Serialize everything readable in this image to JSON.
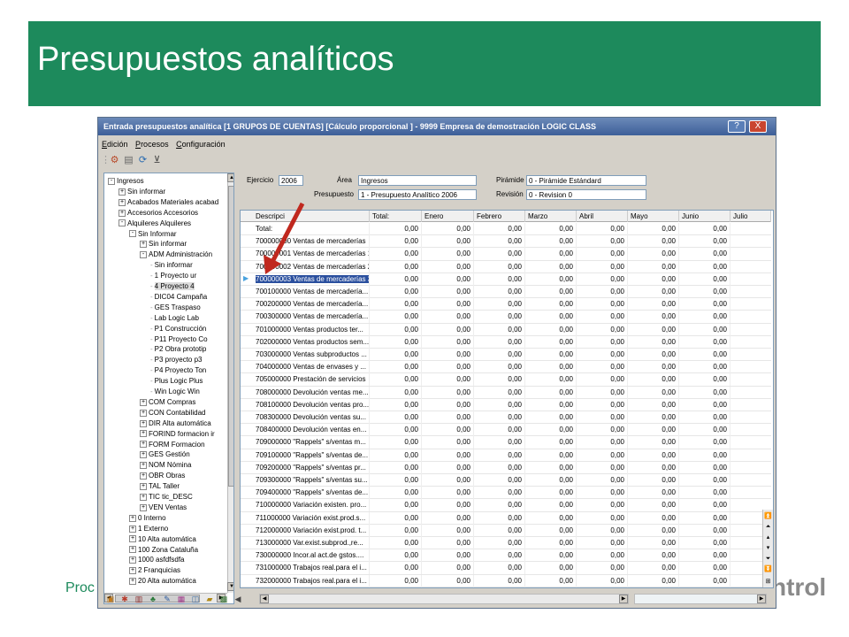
{
  "slide": {
    "title": "Presupuestos analíticos",
    "footer_left": "Proc",
    "footer_right": "ntrol",
    "banner_color": "#1d8a5c"
  },
  "window": {
    "title": "Entrada presupuestos analítica [1 GRUPOS DE CUENTAS] [Cálculo proporcional ] - 9999 Empresa de demostración LOGIC CLASS",
    "help_label": "?",
    "close_label": "X",
    "menu": [
      {
        "label": "Edición",
        "accel": "E"
      },
      {
        "label": "Procesos",
        "accel": "P"
      },
      {
        "label": "Configuración",
        "accel": "C"
      }
    ],
    "toolbar_icons": [
      "properties-icon",
      "document-icon",
      "refresh-icon",
      "filter-clear-icon"
    ]
  },
  "form": {
    "ejercicio_label": "Ejercicio",
    "ejercicio_value": "2006",
    "area_label": "Área",
    "area_value": "Ingresos",
    "piramide_label": "Pirámide",
    "piramide_value": "0 - Pirámide Estándard",
    "presupuesto_label": "Presupuesto",
    "presupuesto_value": "1 - Presupuesto Analítico 2006",
    "revision_label": "Revisión",
    "revision_value": "0 - Revision 0"
  },
  "tree": [
    {
      "label": "Ingresos",
      "level": 0,
      "exp": "-"
    },
    {
      "label": "Sin informar",
      "level": 1,
      "exp": "+"
    },
    {
      "label": "Acabados Materiales acabad",
      "level": 1,
      "exp": "+"
    },
    {
      "label": "Accesorios Accesorios",
      "level": 1,
      "exp": "+"
    },
    {
      "label": "Alquileres Alquileres",
      "level": 1,
      "exp": "-"
    },
    {
      "label": "Sin Informar",
      "level": 2,
      "exp": "-"
    },
    {
      "label": "Sin informar",
      "level": 3,
      "exp": "+"
    },
    {
      "label": "ADM Administración",
      "level": 3,
      "exp": "-"
    },
    {
      "label": "Sin informar",
      "level": 4,
      "exp": ""
    },
    {
      "label": "1    Proyecto ur",
      "level": 4,
      "exp": ""
    },
    {
      "label": "4 Proyecto 4",
      "level": 4,
      "exp": "",
      "selected": true
    },
    {
      "label": "DIC04 Campaña",
      "level": 4,
      "exp": ""
    },
    {
      "label": "GES   Traspaso",
      "level": 4,
      "exp": ""
    },
    {
      "label": "Lab   Logic Lab",
      "level": 4,
      "exp": ""
    },
    {
      "label": "P1 Construcción",
      "level": 4,
      "exp": ""
    },
    {
      "label": "P11 Proyecto Co",
      "level": 4,
      "exp": ""
    },
    {
      "label": "P2 Obra prototip",
      "level": 4,
      "exp": ""
    },
    {
      "label": "P3 proyecto p3",
      "level": 4,
      "exp": ""
    },
    {
      "label": "P4 Proyecto Ton",
      "level": 4,
      "exp": ""
    },
    {
      "label": "Plus   Logic Plus",
      "level": 4,
      "exp": ""
    },
    {
      "label": "Win   Logic Win",
      "level": 4,
      "exp": ""
    },
    {
      "label": "COM Compras",
      "level": 3,
      "exp": "+"
    },
    {
      "label": "CON   Contabilidad",
      "level": 3,
      "exp": "+"
    },
    {
      "label": "DIR Alta automática",
      "level": 3,
      "exp": "+"
    },
    {
      "label": "FORIND formacion ir",
      "level": 3,
      "exp": "+"
    },
    {
      "label": "FORM Formacion",
      "level": 3,
      "exp": "+"
    },
    {
      "label": "GES   Gestión",
      "level": 3,
      "exp": "+"
    },
    {
      "label": "NOM   Nómina",
      "level": 3,
      "exp": "+"
    },
    {
      "label": "OBR Obras",
      "level": 3,
      "exp": "+"
    },
    {
      "label": "TAL Taller",
      "level": 3,
      "exp": "+"
    },
    {
      "label": "TIC tic_DESC",
      "level": 3,
      "exp": "+"
    },
    {
      "label": "VEN Ventas",
      "level": 3,
      "exp": "+"
    },
    {
      "label": "0 Interno",
      "level": 2,
      "exp": "+"
    },
    {
      "label": "1 Externo",
      "level": 2,
      "exp": "+"
    },
    {
      "label": "10 Alta automática",
      "level": 2,
      "exp": "+"
    },
    {
      "label": "100 Zona Cataluña",
      "level": 2,
      "exp": "+"
    },
    {
      "label": "1000 asfdfsdfa",
      "level": 2,
      "exp": "+"
    },
    {
      "label": "2 Franquicias",
      "level": 2,
      "exp": "+"
    },
    {
      "label": "20 Alta automática",
      "level": 2,
      "exp": "+"
    }
  ],
  "grid": {
    "columns": [
      "Descripci",
      "Total:",
      "Enero",
      "Febrero",
      "Marzo",
      "Abril",
      "Mayo",
      "Junio",
      "Julio"
    ],
    "rows": [
      {
        "desc": "Total:",
        "vals": [
          "0,00",
          "0,00",
          "0,00",
          "0,00",
          "0,00",
          "0,00",
          "0,00"
        ]
      },
      {
        "desc": "700000000 Ventas de mercaderías",
        "vals": [
          "0,00",
          "0,00",
          "0,00",
          "0,00",
          "0,00",
          "0,00",
          "0,00"
        ]
      },
      {
        "desc": "700000001 Ventas de mercaderías 1",
        "vals": [
          "0,00",
          "0,00",
          "0,00",
          "0,00",
          "0,00",
          "0,00",
          "0,00"
        ]
      },
      {
        "desc": "700000002 Ventas de mercaderías 2",
        "vals": [
          "0,00",
          "0,00",
          "0,00",
          "0,00",
          "0,00",
          "0,00",
          "0,00"
        ]
      },
      {
        "desc": "700000003 Ventas de mercaderías 3",
        "vals": [
          "0,00",
          "0,00",
          "0,00",
          "0,00",
          "0,00",
          "0,00",
          "0,00"
        ],
        "selected": true
      },
      {
        "desc": "700100000 Ventas de mercadería...",
        "vals": [
          "0,00",
          "0,00",
          "0,00",
          "0,00",
          "0,00",
          "0,00",
          "0,00"
        ]
      },
      {
        "desc": "700200000 Ventas de mercadería...",
        "vals": [
          "0,00",
          "0,00",
          "0,00",
          "0,00",
          "0,00",
          "0,00",
          "0,00"
        ]
      },
      {
        "desc": "700300000 Ventas de mercadería...",
        "vals": [
          "0,00",
          "0,00",
          "0,00",
          "0,00",
          "0,00",
          "0,00",
          "0,00"
        ]
      },
      {
        "desc": "701000000 Ventas productos ter...",
        "vals": [
          "0,00",
          "0,00",
          "0,00",
          "0,00",
          "0,00",
          "0,00",
          "0,00"
        ]
      },
      {
        "desc": "702000000 Ventas productos sem...",
        "vals": [
          "0,00",
          "0,00",
          "0,00",
          "0,00",
          "0,00",
          "0,00",
          "0,00"
        ]
      },
      {
        "desc": "703000000 Ventas subproductos ...",
        "vals": [
          "0,00",
          "0,00",
          "0,00",
          "0,00",
          "0,00",
          "0,00",
          "0,00"
        ]
      },
      {
        "desc": "704000000 Ventas de envases y ...",
        "vals": [
          "0,00",
          "0,00",
          "0,00",
          "0,00",
          "0,00",
          "0,00",
          "0,00"
        ]
      },
      {
        "desc": "705000000 Prestación de servicios",
        "vals": [
          "0,00",
          "0,00",
          "0,00",
          "0,00",
          "0,00",
          "0,00",
          "0,00"
        ]
      },
      {
        "desc": "708000000 Devolución ventas me...",
        "vals": [
          "0,00",
          "0,00",
          "0,00",
          "0,00",
          "0,00",
          "0,00",
          "0,00"
        ]
      },
      {
        "desc": "708100000 Devolución ventas pro...",
        "vals": [
          "0,00",
          "0,00",
          "0,00",
          "0,00",
          "0,00",
          "0,00",
          "0,00"
        ]
      },
      {
        "desc": "708300000 Devolución ventas su...",
        "vals": [
          "0,00",
          "0,00",
          "0,00",
          "0,00",
          "0,00",
          "0,00",
          "0,00"
        ]
      },
      {
        "desc": "708400000 Devolución ventas en...",
        "vals": [
          "0,00",
          "0,00",
          "0,00",
          "0,00",
          "0,00",
          "0,00",
          "0,00"
        ]
      },
      {
        "desc": "709000000 \"Rappels\" s/ventas m...",
        "vals": [
          "0,00",
          "0,00",
          "0,00",
          "0,00",
          "0,00",
          "0,00",
          "0,00"
        ]
      },
      {
        "desc": "709100000 \"Rappels\" s/ventas de...",
        "vals": [
          "0,00",
          "0,00",
          "0,00",
          "0,00",
          "0,00",
          "0,00",
          "0,00"
        ]
      },
      {
        "desc": "709200000 \"Rappels\" s/ventas pr...",
        "vals": [
          "0,00",
          "0,00",
          "0,00",
          "0,00",
          "0,00",
          "0,00",
          "0,00"
        ]
      },
      {
        "desc": "709300000 \"Rappels\" s/ventas su...",
        "vals": [
          "0,00",
          "0,00",
          "0,00",
          "0,00",
          "0,00",
          "0,00",
          "0,00"
        ]
      },
      {
        "desc": "709400000 \"Rappels\" s/ventas de...",
        "vals": [
          "0,00",
          "0,00",
          "0,00",
          "0,00",
          "0,00",
          "0,00",
          "0,00"
        ]
      },
      {
        "desc": "710000000 Variación existen. pro...",
        "vals": [
          "0,00",
          "0,00",
          "0,00",
          "0,00",
          "0,00",
          "0,00",
          "0,00"
        ]
      },
      {
        "desc": "711000000 Variación exist.prod.s...",
        "vals": [
          "0,00",
          "0,00",
          "0,00",
          "0,00",
          "0,00",
          "0,00",
          "0,00"
        ]
      },
      {
        "desc": "712000000 Variación exist.prod. t...",
        "vals": [
          "0,00",
          "0,00",
          "0,00",
          "0,00",
          "0,00",
          "0,00",
          "0,00"
        ]
      },
      {
        "desc": "713000000 Var.exist.subprod.,re...",
        "vals": [
          "0,00",
          "0,00",
          "0,00",
          "0,00",
          "0,00",
          "0,00",
          "0,00"
        ]
      },
      {
        "desc": "730000000 Incor.al act.de gstos....",
        "vals": [
          "0,00",
          "0,00",
          "0,00",
          "0,00",
          "0,00",
          "0,00",
          "0,00"
        ]
      },
      {
        "desc": "731000000 Trabajos real.para el i...",
        "vals": [
          "0,00",
          "0,00",
          "0,00",
          "0,00",
          "0,00",
          "0,00",
          "0,00"
        ]
      },
      {
        "desc": "732000000 Trabajos real.para el i...",
        "vals": [
          "0,00",
          "0,00",
          "0,00",
          "0,00",
          "0,00",
          "0,00",
          "0,00"
        ]
      }
    ]
  },
  "row_selector_glyph": "▶",
  "arrow_color": "#c0281e"
}
